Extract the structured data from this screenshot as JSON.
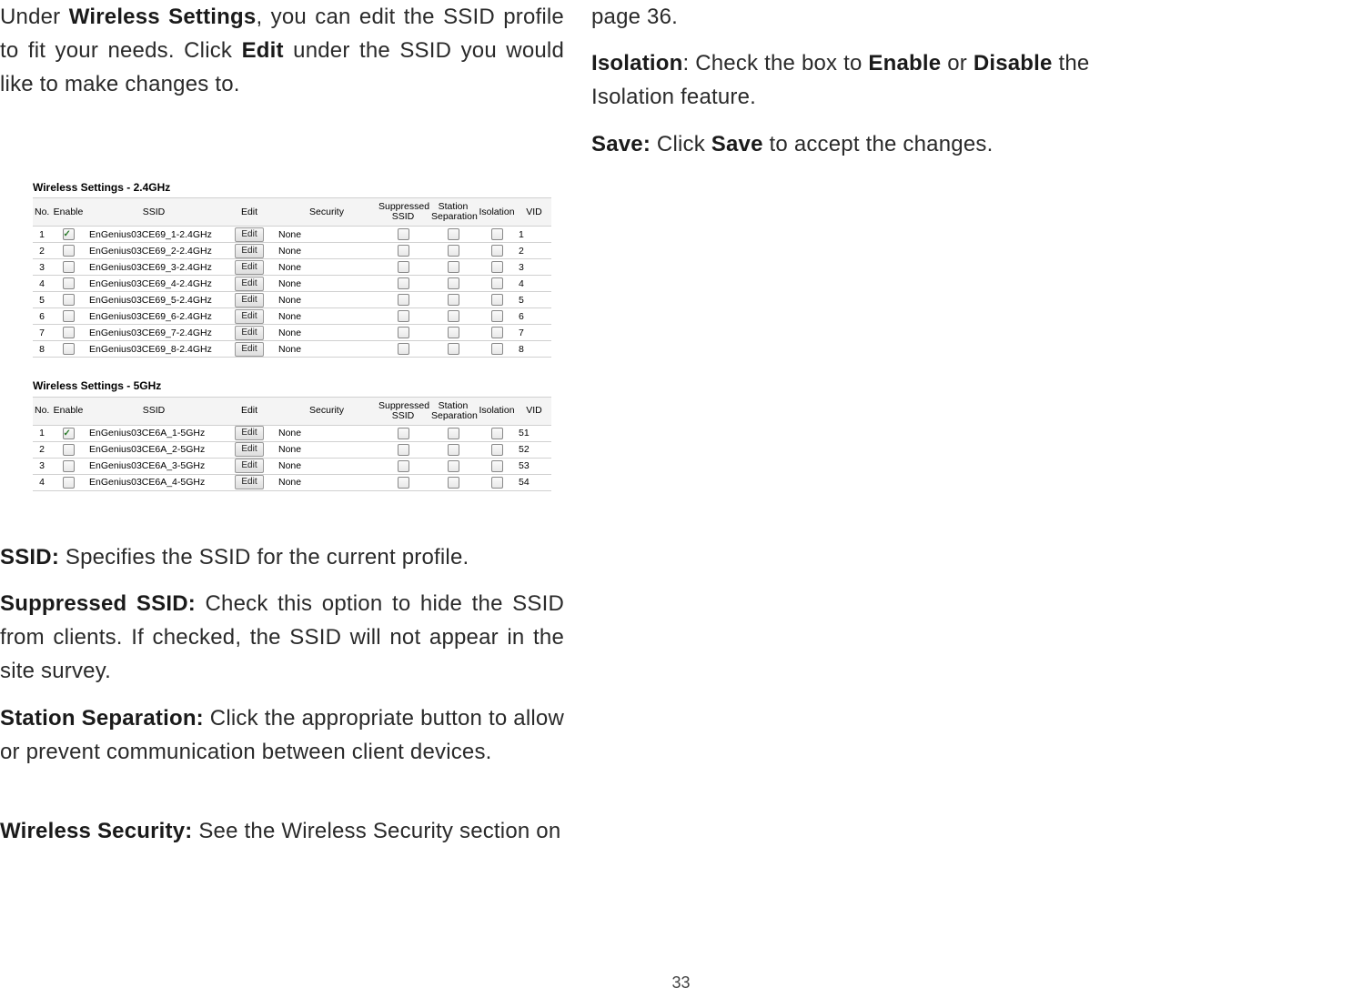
{
  "page_number": "33",
  "left": {
    "intro": {
      "pre": "Under",
      "bold1": "Wireless Settings",
      "mid1": ", you can edit the SSID profile to fit your needs. Click",
      "bold2": "Edit",
      "post": "under the SSID you would like to make changes to."
    },
    "table24": {
      "title": "Wireless Settings - 2.4GHz",
      "headers": [
        "No.",
        "Enable",
        "SSID",
        "Edit",
        "Security",
        "Suppressed SSID",
        "Station Separation",
        "Isolation",
        "VID"
      ],
      "edit_label": "Edit",
      "rows": [
        {
          "no": "1",
          "enable": true,
          "ssid": "EnGenius03CE69_1-2.4GHz",
          "security": "None",
          "sup": false,
          "sep": false,
          "iso": false,
          "vid": "1"
        },
        {
          "no": "2",
          "enable": false,
          "ssid": "EnGenius03CE69_2-2.4GHz",
          "security": "None",
          "sup": false,
          "sep": false,
          "iso": false,
          "vid": "2"
        },
        {
          "no": "3",
          "enable": false,
          "ssid": "EnGenius03CE69_3-2.4GHz",
          "security": "None",
          "sup": false,
          "sep": false,
          "iso": false,
          "vid": "3"
        },
        {
          "no": "4",
          "enable": false,
          "ssid": "EnGenius03CE69_4-2.4GHz",
          "security": "None",
          "sup": false,
          "sep": false,
          "iso": false,
          "vid": "4"
        },
        {
          "no": "5",
          "enable": false,
          "ssid": "EnGenius03CE69_5-2.4GHz",
          "security": "None",
          "sup": false,
          "sep": false,
          "iso": false,
          "vid": "5"
        },
        {
          "no": "6",
          "enable": false,
          "ssid": "EnGenius03CE69_6-2.4GHz",
          "security": "None",
          "sup": false,
          "sep": false,
          "iso": false,
          "vid": "6"
        },
        {
          "no": "7",
          "enable": false,
          "ssid": "EnGenius03CE69_7-2.4GHz",
          "security": "None",
          "sup": false,
          "sep": false,
          "iso": false,
          "vid": "7"
        },
        {
          "no": "8",
          "enable": false,
          "ssid": "EnGenius03CE69_8-2.4GHz",
          "security": "None",
          "sup": false,
          "sep": false,
          "iso": false,
          "vid": "8"
        }
      ]
    },
    "table5": {
      "title": "Wireless Settings - 5GHz",
      "headers": [
        "No.",
        "Enable",
        "SSID",
        "Edit",
        "Security",
        "Suppressed SSID",
        "Station Separation",
        "Isolation",
        "VID"
      ],
      "edit_label": "Edit",
      "rows": [
        {
          "no": "1",
          "enable": true,
          "ssid": "EnGenius03CE6A_1-5GHz",
          "security": "None",
          "sup": false,
          "sep": false,
          "iso": false,
          "vid": "51"
        },
        {
          "no": "2",
          "enable": false,
          "ssid": "EnGenius03CE6A_2-5GHz",
          "security": "None",
          "sup": false,
          "sep": false,
          "iso": false,
          "vid": "52"
        },
        {
          "no": "3",
          "enable": false,
          "ssid": "EnGenius03CE6A_3-5GHz",
          "security": "None",
          "sup": false,
          "sep": false,
          "iso": false,
          "vid": "53"
        },
        {
          "no": "4",
          "enable": false,
          "ssid": "EnGenius03CE6A_4-5GHz",
          "security": "None",
          "sup": false,
          "sep": false,
          "iso": false,
          "vid": "54"
        }
      ]
    },
    "defs": {
      "ssid": {
        "term": "SSID:",
        "text": " Specifies the SSID for the current profile."
      },
      "sup": {
        "term": "Suppressed SSID:",
        "text": " Check this option to hide the SSID from clients. If checked, the SSID will not appear in the site survey."
      },
      "sep": {
        "term": "Station Separation:",
        "text": " Click the appropriate button to allow or prevent communication between client devices."
      },
      "wsec": {
        "term": "Wireless Security:",
        "text": " See the Wireless Security section on"
      }
    }
  },
  "right": {
    "pageref": "page 36.",
    "isolation": {
      "term": "Isolation",
      "mid": ": Check the box to",
      "b1": "Enable",
      "mid2": "or",
      "b2": "Disable",
      "post": "the Isolation feature."
    },
    "save": {
      "term": "Save:",
      "mid": " Click",
      "b1": "Save",
      "post": "to accept the changes."
    }
  }
}
